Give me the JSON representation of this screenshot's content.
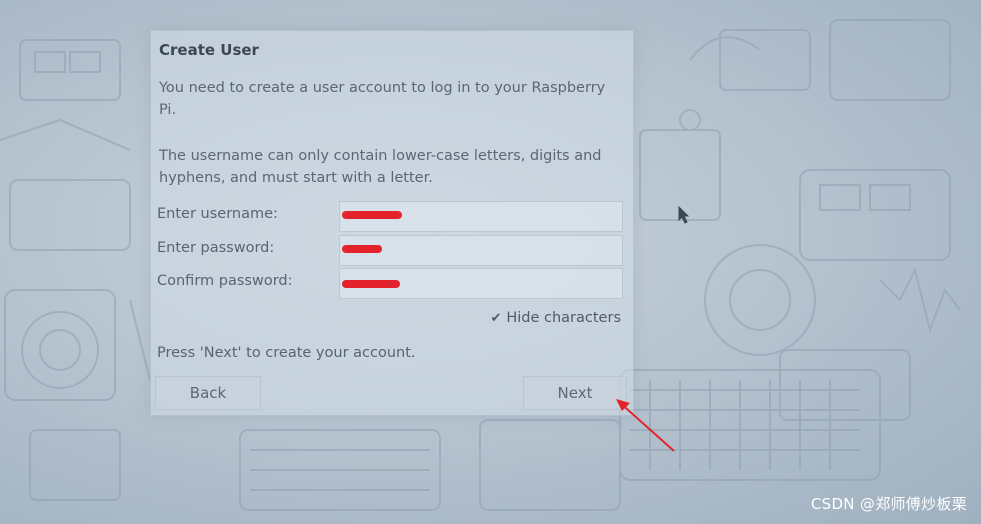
{
  "dialog": {
    "title": "Create User",
    "message_intro": "You need to create a user account to log in to your Raspberry Pi.",
    "message_rules": "The username can only contain lower-case letters, digits and hyphens, and must start with a letter.",
    "fields": [
      {
        "label": "Enter username:",
        "value": ""
      },
      {
        "label": "Enter password:",
        "value": ""
      },
      {
        "label": "Confirm password:",
        "value": ""
      }
    ],
    "hide_characters": {
      "label": "Hide characters",
      "checked": true
    },
    "footer_message": "Press 'Next' to create your account.",
    "back_label": "Back",
    "next_label": "Next"
  },
  "annotation": {
    "color": "#e4222c",
    "redaction_color": "#e4222c"
  },
  "watermark": "CSDN @郑师傅炒板栗"
}
